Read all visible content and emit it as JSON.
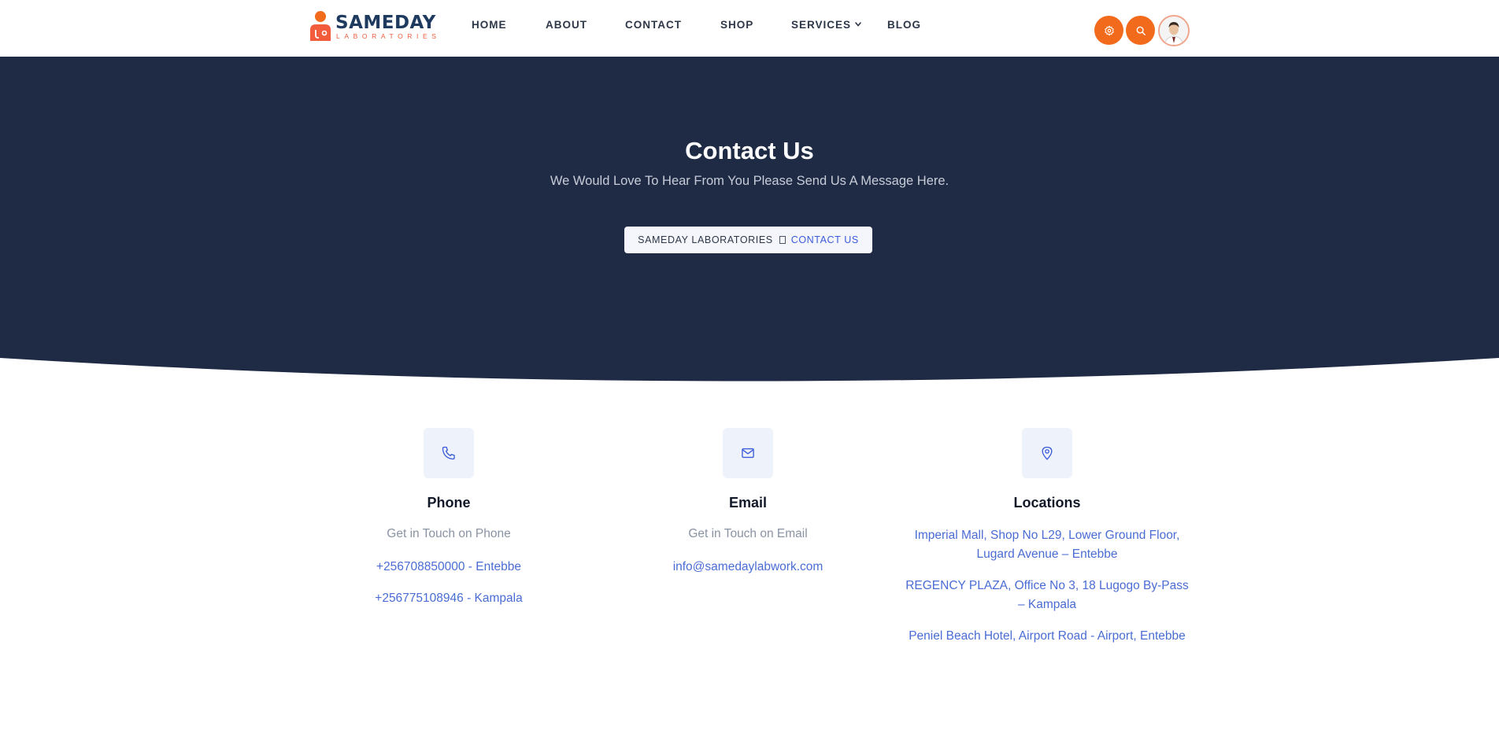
{
  "brand": {
    "name": "SAMEDAY",
    "tagline": "LABORATORIES",
    "colors": {
      "navy": "#1f2a44",
      "orange": "#f26b1d",
      "accent_blue": "#4a6cd4"
    }
  },
  "nav": {
    "items": [
      {
        "label": "HOME"
      },
      {
        "label": "ABOUT"
      },
      {
        "label": "CONTACT"
      },
      {
        "label": "SHOP"
      },
      {
        "label": "SERVICES",
        "has_dropdown": true
      },
      {
        "label": "BLOG"
      }
    ]
  },
  "header_actions": {
    "settings_icon": "gear-icon",
    "search_icon": "search-icon",
    "avatar": "user-avatar"
  },
  "hero": {
    "title": "Contact Us",
    "subtitle": "We Would Love To Hear From You Please Send Us A Message Here.",
    "breadcrumb": {
      "home": "SAMEDAY LABORATORIES",
      "current": "CONTACT US"
    }
  },
  "contact": {
    "phone": {
      "icon": "phone-icon",
      "title": "Phone",
      "lead": "Get in Touch on Phone",
      "numbers": [
        "+256708850000 - Entebbe",
        "+256775108946 - Kampala"
      ]
    },
    "email": {
      "icon": "mail-icon",
      "title": "Email",
      "lead": "Get in Touch on Email",
      "address": "info@samedaylabwork.com"
    },
    "locations": {
      "icon": "map-pin-icon",
      "title": "Locations",
      "items": [
        "Imperial Mall, Shop No L29, Lower Ground Floor, Lugard Avenue – Entebbe",
        "REGENCY PLAZA, Office No 3, 18 Lugogo By-Pass – Kampala",
        "Peniel Beach Hotel, Airport Road - Airport, Entebbe"
      ]
    }
  }
}
